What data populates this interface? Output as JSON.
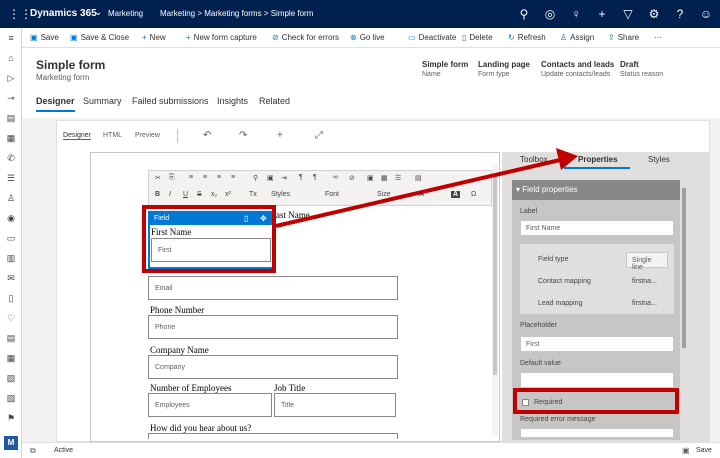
{
  "topbar": {
    "app_name": "Dynamics 365",
    "area": "Marketing",
    "breadcrumb": "Marketing > Marketing forms > Simple form",
    "icons": [
      "search-icon",
      "target-icon",
      "lightbulb-icon",
      "plus-icon",
      "filter-icon",
      "gear-icon",
      "help-icon",
      "user-icon"
    ]
  },
  "commands": {
    "save": "Save",
    "save_close": "Save & Close",
    "new": "New",
    "new_capture": "New form capture",
    "check_errors": "Check for errors",
    "go_live": "Go live",
    "deactivate": "Deactivate",
    "delete": "Delete",
    "refresh": "Refresh",
    "assign": "Assign",
    "share": "Share",
    "more": "···"
  },
  "header": {
    "title": "Simple form",
    "subtitle": "Marketing form",
    "fields": [
      {
        "value": "Simple form",
        "label": "Name"
      },
      {
        "value": "Landing page",
        "label": "Form type"
      },
      {
        "value": "Contacts and leads",
        "label": "Update contacts/leads"
      },
      {
        "value": "Draft",
        "label": "Status reason"
      }
    ],
    "tabs": [
      "Designer",
      "Summary",
      "Failed submissions",
      "Insights",
      "Related"
    ]
  },
  "designer": {
    "subtabs": [
      "Designer",
      "HTML",
      "Preview"
    ]
  },
  "toolbar": {
    "styles": "Styles",
    "font": "Font",
    "size": "Size"
  },
  "form": {
    "field_badge": "Field",
    "first_name_label": "First Name",
    "first_name_ph": "First",
    "last_name_label": "ast Name",
    "email_ph": "Email",
    "phone_label": "Phone Number",
    "phone_ph": "Phone",
    "company_label": "Company Name",
    "company_ph": "Company",
    "employees_label": "Number of Employees",
    "employees_ph": "Employees",
    "jobtitle_label": "Job Title",
    "jobtitle_ph": "Title",
    "hear_label": "How did you hear about us?"
  },
  "panel": {
    "tabs": [
      "Toolbox",
      "Properties",
      "Styles"
    ],
    "section": "Field properties",
    "label_title": "Label",
    "label_value": "First Name",
    "field_type_label": "Field type",
    "field_type_value": "Single line",
    "contact_mapping_label": "Contact mapping",
    "contact_mapping_value": "firstna...",
    "lead_mapping_label": "Lead mapping",
    "lead_mapping_value": "firstna...",
    "placeholder_title": "Placeholder",
    "placeholder_value": "First",
    "default_value_title": "Default value",
    "required_label": "Required",
    "required_error_title": "Required error message"
  },
  "status": {
    "state": "Active",
    "save": "Save"
  },
  "colors": {
    "topbar": "#002050",
    "accent": "#0078d4",
    "highlight": "#c00000"
  }
}
